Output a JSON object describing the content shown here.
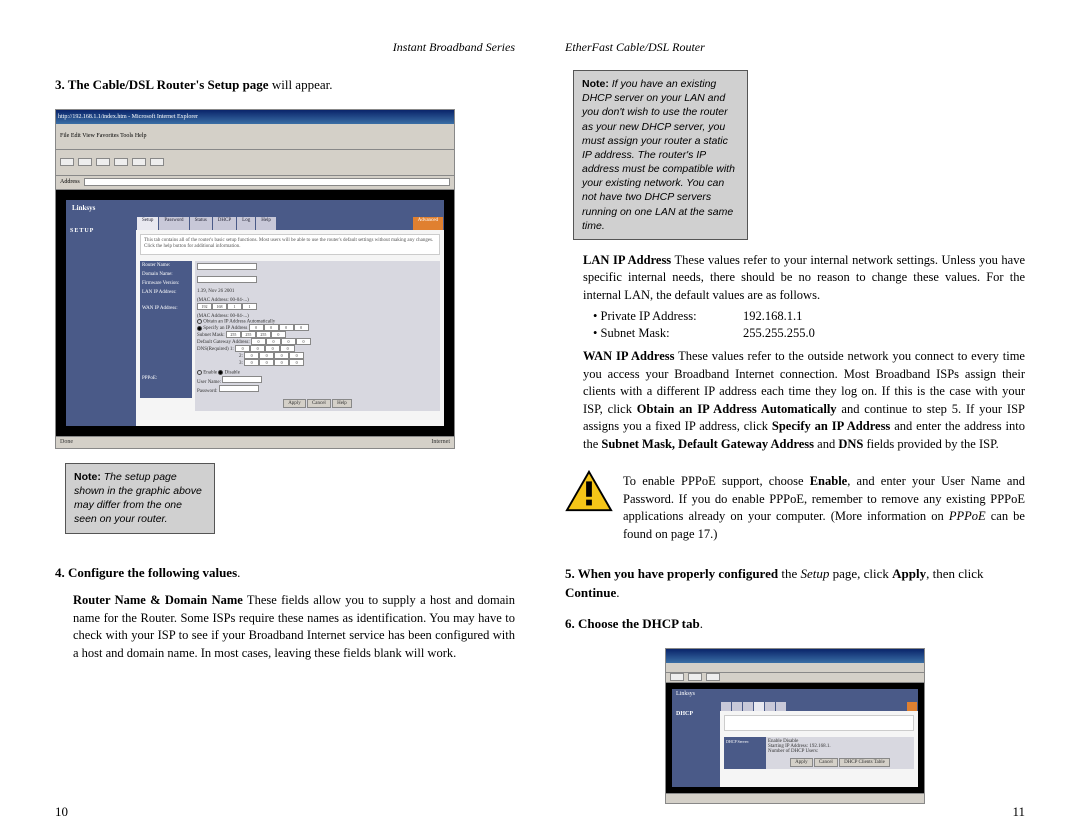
{
  "left": {
    "header": "Instant Broadband Series",
    "step3_bold": "3. The Cable/DSL Router's Setup page",
    "step3_rest": " will appear.",
    "note_label": "Note:",
    "note_text": " The setup page shown in the graphic above may differ from the one seen on your router.",
    "step4_bold": "4. Configure the following values",
    "step4_rest": ".",
    "rn_bold": "Router Name & Domain Name",
    "rn_text": "  These fields allow you to supply a host and domain name for the Router. Some ISPs require these names as identification. You may have to check with your ISP to see if your Broadband Internet service has been configured with a host and domain name. In most cases, leaving these fields blank will work.",
    "page_num": "10",
    "shot": {
      "titlebar": "http://192.168.1.1/index.htm - Microsoft Internet Explorer",
      "menu": "File  Edit  View  Favorites  Tools  Help",
      "brand": "Linksys",
      "setup": "SETUP",
      "tabs": [
        "Setup",
        "Password",
        "Status",
        "DHCP",
        "Log",
        "Help"
      ],
      "tab_adv": "Advanced",
      "desc": "This tab contains all of the router's basic setup functions. Most users will be able to use the router's default settings without making any changes. Click the help button for additional information.",
      "labels": {
        "router_name": "Router Name:",
        "domain_name": "Domain Name:",
        "firmware": "Firmware Version:",
        "lan": "LAN IP Address:",
        "wan": "WAN IP Address:",
        "pppoe": "PPPoE:"
      },
      "fw_value": "1.39, Nov 26 2001",
      "mac": "(MAC Address: 00-04-...)",
      "ip_device": "192 . 168 . 1 . 1",
      "opt_obtain": "Obtain an IP Address Automatically",
      "opt_specify": "Specify an IP Address",
      "sm": "Subnet Mask:",
      "gw": "Default Gateway Address:",
      "dns": "DNS(Required)",
      "enable": "Enable",
      "disable": "Disable",
      "user": "User Name:",
      "pass": "Password:",
      "btn_apply": "Apply",
      "btn_cancel": "Cancel",
      "btn_help": "Help",
      "status_done": "Done",
      "status_net": "Internet"
    }
  },
  "right": {
    "header": "EtherFast Cable/DSL Router",
    "note_label": "Note:",
    "note_text": " If you have an existing DHCP server on your LAN and you don't wish to use the router as your new DHCP server, you must assign your router a static IP address. The router's IP address must be compatible with your existing network. You can not have two DHCP servers running on one LAN at the same time.",
    "lan_bold": "LAN IP Address",
    "lan_text": "  These values refer to your internal network settings. Unless you have specific internal needs, there should be no reason to change these values. For the internal LAN, the default values are as follows.",
    "priv_label": "• Private IP Address:",
    "priv_value": "192.168.1.1",
    "sm_label": "• Subnet Mask:",
    "sm_value": "255.255.255.0",
    "wan_bold": "WAN IP Address",
    "wan_text1": "  These values refer to the outside network you connect to every time you access your Broadband Internet connection. Most Broadband ISPs assign their clients with a different IP address each time they log on. If this is the case with your ISP, click ",
    "wan_b1": "Obtain an IP Address Automatically",
    "wan_text2": " and continue to step 5. If your ISP assigns you a fixed IP address, click ",
    "wan_b2": "Specify an IP Address",
    "wan_text3": " and enter the address into the ",
    "wan_b3": "Subnet Mask, Default Gateway Address",
    "wan_text4": " and ",
    "wan_b4": "DNS",
    "wan_text5": " fields provided by the ISP.",
    "warn_text1": "To enable PPPoE support, choose ",
    "warn_b1": "Enable",
    "warn_text2": ", and enter your User Name and Password. If you do enable PPPoE, remember to remove any existing PPPoE applications already on your computer. (More information on ",
    "warn_i1": "PPPoE",
    "warn_text3": " can be found on page 17.)",
    "step5_bold1": "5. When you have properly configured",
    "step5_text1": " the ",
    "step5_i1": "Setup",
    "step5_text2": " page, click ",
    "step5_b2": "Apply",
    "step5_text3": ", then click ",
    "step5_b3": "Continue",
    "step5_text4": ".",
    "step6_bold": "6. Choose the DHCP tab",
    "step6_rest": ".",
    "page_num": "11",
    "shot": {
      "brand": "Linksys",
      "title": "DHCP",
      "opt": "Enable   Disable",
      "start": "Starting IP Address: 192.168.1.",
      "num": "Number of DHCP Users:",
      "btn_apply": "Apply",
      "btn_cancel": "Cancel",
      "btn_table": "DHCP Clients Table"
    }
  }
}
